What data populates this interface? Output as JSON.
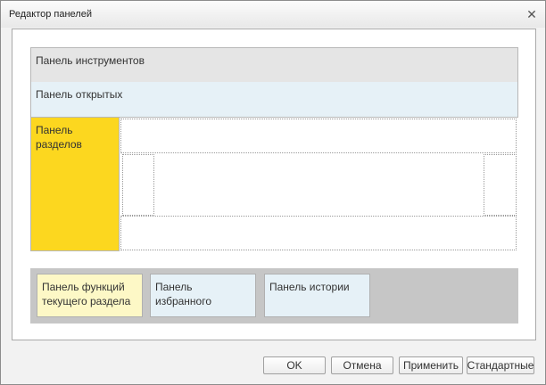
{
  "window": {
    "title": "Редактор панелей"
  },
  "panels": {
    "tools": "Панель инструментов",
    "open": "Панель открытых",
    "sections_line1": "Панель",
    "sections_line2": "разделов",
    "functions_line1": "Панель функций",
    "functions_line2": "текущего раздела",
    "favorites_line1": "Панель",
    "favorites_line2": "избранного",
    "history": "Панель истории"
  },
  "buttons": {
    "ok": "OK",
    "cancel": "Отмена",
    "apply": "Применить",
    "defaults": "Стандартные"
  },
  "colors": {
    "sections_panel": "#fcd71f",
    "functions_panel": "#fdf8c6",
    "open_panel": "#e6f1f7",
    "tools_panel": "#e5e5e5",
    "bottom_area": "#c6c6c6"
  },
  "icons": {
    "close": "close-icon"
  }
}
